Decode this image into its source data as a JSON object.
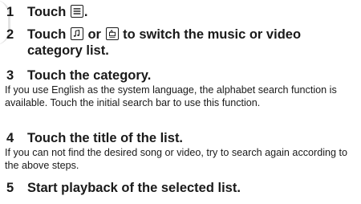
{
  "steps": [
    {
      "number": "1",
      "title_before": "Touch",
      "title_after": ".",
      "icons": [
        "list-menu-icon"
      ]
    },
    {
      "number": "2",
      "title_before": "Touch",
      "title_middle": "or",
      "title_after": "to switch the music or video category list.",
      "icons": [
        "music-note-icon",
        "video-icon"
      ]
    },
    {
      "number": "3",
      "title": "Touch the category.",
      "body": "If you use English as the system language, the alphabet search function is available. Touch the initial search bar to use this function."
    },
    {
      "number": "4",
      "title": "Touch the title of the list.",
      "body": "If you can not find the desired song or video, try to search again according to the above steps."
    },
    {
      "number": "5",
      "title": "Start playback of the selected list."
    }
  ]
}
